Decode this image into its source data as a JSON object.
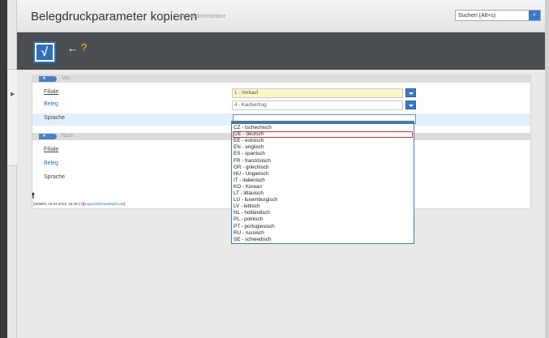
{
  "header": {
    "title": "Belegdruckparameter kopieren",
    "subtitle": "Systemadministrator",
    "search_value": "Suchen (Alt+s)"
  },
  "toolbar": {
    "confirm_glyph": "√",
    "back_glyph": "←",
    "help_glyph": "?"
  },
  "sections": {
    "von": {
      "label": "Von",
      "fields": {
        "filiale": {
          "label": "Filiale",
          "value": "1 - Verkauf"
        },
        "beleg": {
          "label": "Beleg",
          "value": "4 - Kaufvertrag"
        },
        "sprache": {
          "label": "Sprache",
          "value": ""
        }
      }
    },
    "nach": {
      "label": "Nach",
      "fields": {
        "filiale": {
          "label": "Filiale"
        },
        "beleg": {
          "label": "Beleg"
        },
        "sprache": {
          "label": "Sprache"
        }
      }
    }
  },
  "footer": {
    "up_glyph": "🠕",
    "status_prefix": "[ADMIN, 15.04.2014, 15:29:17][",
    "status_email": "support@mosdetpilot.de",
    "status_suffix": "]"
  },
  "dropdown": {
    "selected_index": 1,
    "options": [
      "CZ - tschechisch",
      "DE - deutsch",
      "EE - estnisch",
      "EN - englisch",
      "ES - spanisch",
      "FR - französisch",
      "GR - griechisch",
      "HU - Ungarisch",
      "IT - italienisch",
      "KO - Korean",
      "LT - littauisch",
      "LU - luxemburgisch",
      "LV - lettisch",
      "NL - holländisch",
      "PL - polnisch",
      "PT - portugiesisch",
      "RU - russisch",
      "SE - schwedisch"
    ]
  },
  "colors": {
    "accent": "#2f6fb6",
    "toolbar_bg": "#4a4d52",
    "required_field": "#fbf6c8",
    "selected_border": "#d43030"
  }
}
